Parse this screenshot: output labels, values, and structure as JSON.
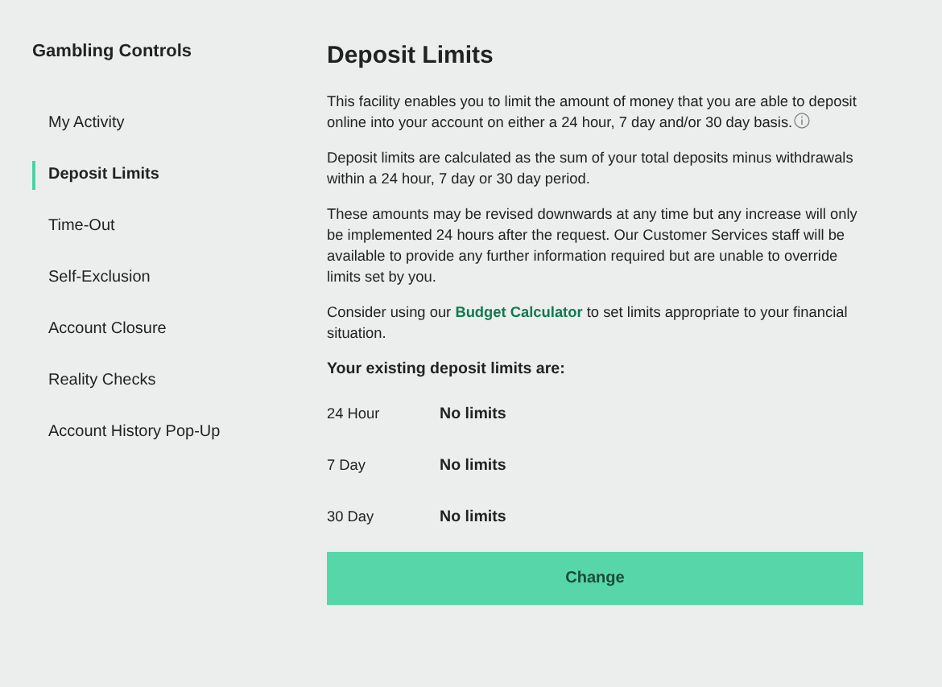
{
  "sidebar": {
    "title": "Gambling Controls",
    "items": [
      {
        "label": "My Activity",
        "selected": false
      },
      {
        "label": "Deposit Limits",
        "selected": true
      },
      {
        "label": "Time-Out",
        "selected": false
      },
      {
        "label": "Self-Exclusion",
        "selected": false
      },
      {
        "label": "Account Closure",
        "selected": false
      },
      {
        "label": "Reality Checks",
        "selected": false
      },
      {
        "label": "Account History Pop-Up",
        "selected": false
      }
    ]
  },
  "main": {
    "title": "Deposit Limits",
    "intro": "This facility enables you to limit the amount of money that you are able to deposit online into your account on either a 24 hour, 7 day and/or 30 day basis.",
    "paragraphs": [
      "Deposit limits are calculated as the sum of your total deposits minus withdrawals within a 24 hour, 7 day or 30 day period.",
      "These amounts may be revised downwards at any time but any increase will only be implemented 24 hours after the request. Our Customer Services staff will be available to provide any further information required but are unable to override limits set by you."
    ],
    "consider": {
      "before": "Consider using our",
      "link": "Budget Calculator",
      "after": "to set limits appropriate to your financial situation."
    },
    "limits_heading": "Your existing deposit limits are:",
    "limits": [
      {
        "period": "24 Hour",
        "value": "No limits"
      },
      {
        "period": "7 Day",
        "value": "No limits"
      },
      {
        "period": "30 Day",
        "value": "No limits"
      }
    ],
    "button": "Change"
  }
}
